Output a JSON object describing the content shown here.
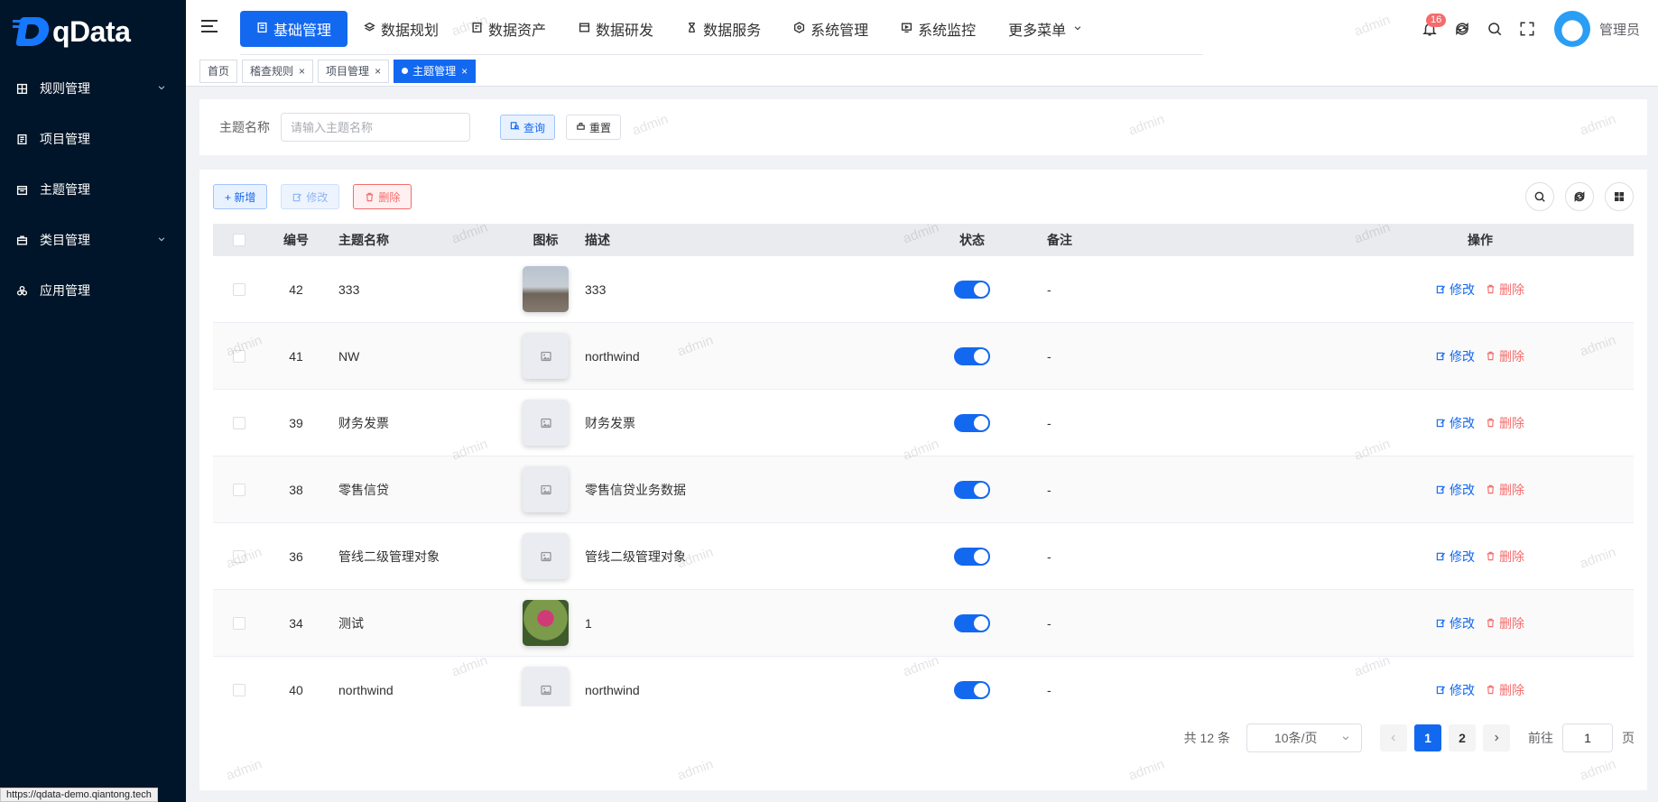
{
  "app": {
    "logo_text": "qData"
  },
  "sidebar": {
    "items": [
      {
        "label": "规则管理",
        "has_arrow": true,
        "icon": "grid-icon"
      },
      {
        "label": "项目管理",
        "has_arrow": false,
        "icon": "doc-list-icon"
      },
      {
        "label": "主题管理",
        "has_arrow": false,
        "icon": "calendar-box-icon"
      },
      {
        "label": "类目管理",
        "has_arrow": true,
        "icon": "briefcase-icon"
      },
      {
        "label": "应用管理",
        "has_arrow": false,
        "icon": "cubes-icon"
      }
    ]
  },
  "topnav": {
    "items": [
      {
        "label": "基础管理",
        "active": true
      },
      {
        "label": "数据规划"
      },
      {
        "label": "数据资产"
      },
      {
        "label": "数据研发"
      },
      {
        "label": "数据服务"
      },
      {
        "label": "系统管理"
      },
      {
        "label": "系统监控"
      },
      {
        "label": "更多菜单"
      }
    ]
  },
  "header": {
    "notification_count": "16",
    "username": "管理员"
  },
  "tabs": [
    {
      "label": "首页",
      "closable": false
    },
    {
      "label": "稽查规则",
      "closable": true
    },
    {
      "label": "项目管理",
      "closable": true
    },
    {
      "label": "主题管理",
      "closable": true,
      "active": true
    }
  ],
  "search": {
    "label": "主题名称",
    "placeholder": "请输入主题名称",
    "query_label": "查询",
    "reset_label": "重置"
  },
  "toolbar": {
    "add_label": "+ 新增",
    "edit_label": "修改",
    "delete_label": "删除"
  },
  "table": {
    "columns": {
      "id": "编号",
      "name": "主题名称",
      "icon": "图标",
      "desc": "描述",
      "status": "状态",
      "remark": "备注",
      "ops": "操作"
    },
    "edit_label": "修改",
    "delete_label": "删除",
    "rows": [
      {
        "id": "42",
        "name": "333",
        "icon": "photo-street",
        "desc": "333",
        "status": true,
        "remark": "-"
      },
      {
        "id": "41",
        "name": "NW",
        "icon": "placeholder",
        "desc": "northwind",
        "status": true,
        "remark": "-"
      },
      {
        "id": "39",
        "name": "财务发票",
        "icon": "placeholder",
        "desc": "财务发票",
        "status": true,
        "remark": "-"
      },
      {
        "id": "38",
        "name": "零售信贷",
        "icon": "placeholder",
        "desc": "零售信贷业务数据",
        "status": true,
        "remark": "-"
      },
      {
        "id": "36",
        "name": "管线二级管理对象",
        "icon": "placeholder",
        "desc": "管线二级管理对象",
        "status": true,
        "remark": "-"
      },
      {
        "id": "34",
        "name": "测试",
        "icon": "photo-flower",
        "desc": "1",
        "status": true,
        "remark": "-"
      },
      {
        "id": "40",
        "name": "northwind",
        "icon": "placeholder",
        "desc": "northwind",
        "status": true,
        "remark": "-"
      }
    ]
  },
  "pagination": {
    "total_text": "共 12 条",
    "page_size": "10条/页",
    "pages": [
      "1",
      "2"
    ],
    "current_page": "1",
    "goto_prefix": "前往",
    "goto_value": "1",
    "goto_suffix": "页"
  },
  "watermark_text": "admin",
  "status_url": "https://qdata-demo.qiantong.tech",
  "colors": {
    "primary": "#1368f0",
    "danger": "#f56c6c",
    "sidebar_bg": "#001529"
  }
}
